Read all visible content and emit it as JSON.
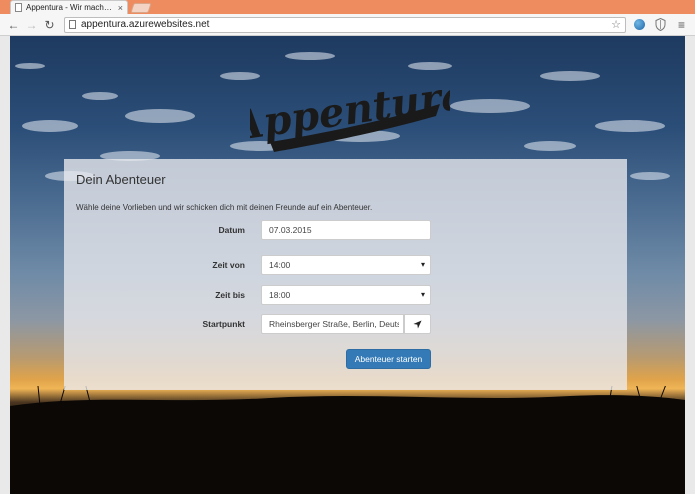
{
  "browser": {
    "tab_title": "Appentura - Wir machen ...",
    "tab_close": "×",
    "url": "appentura.azurewebsites.net",
    "nav": {
      "back": "←",
      "forward": "→",
      "reload": "↻"
    },
    "star": "☆",
    "menu": "≡"
  },
  "logo": {
    "text": "Appentura"
  },
  "form": {
    "title": "Dein Abenteuer",
    "intro": "Wähle deine Vorlieben und wir schicken dich mit deinen Freunde auf ein Abenteuer.",
    "date_label": "Datum",
    "date_value": "07.03.2015",
    "time_from_label": "Zeit von",
    "time_from_value": "14:00",
    "time_to_label": "Zeit bis",
    "time_to_value": "18:00",
    "start_label": "Startpunkt",
    "start_value": "Rheinsberger Straße, Berlin, Deuts",
    "submit_label": "Abenteuer starten"
  },
  "colors": {
    "tabbar": "#ef8c5f",
    "primary_button": "#337ab7"
  },
  "icons": [
    "page-icon",
    "close-icon",
    "back-icon",
    "forward-icon",
    "reload-icon",
    "star-icon",
    "globe-icon",
    "shield-icon",
    "menu-icon",
    "location-arrow-icon",
    "dropdown-arrow-icon"
  ]
}
